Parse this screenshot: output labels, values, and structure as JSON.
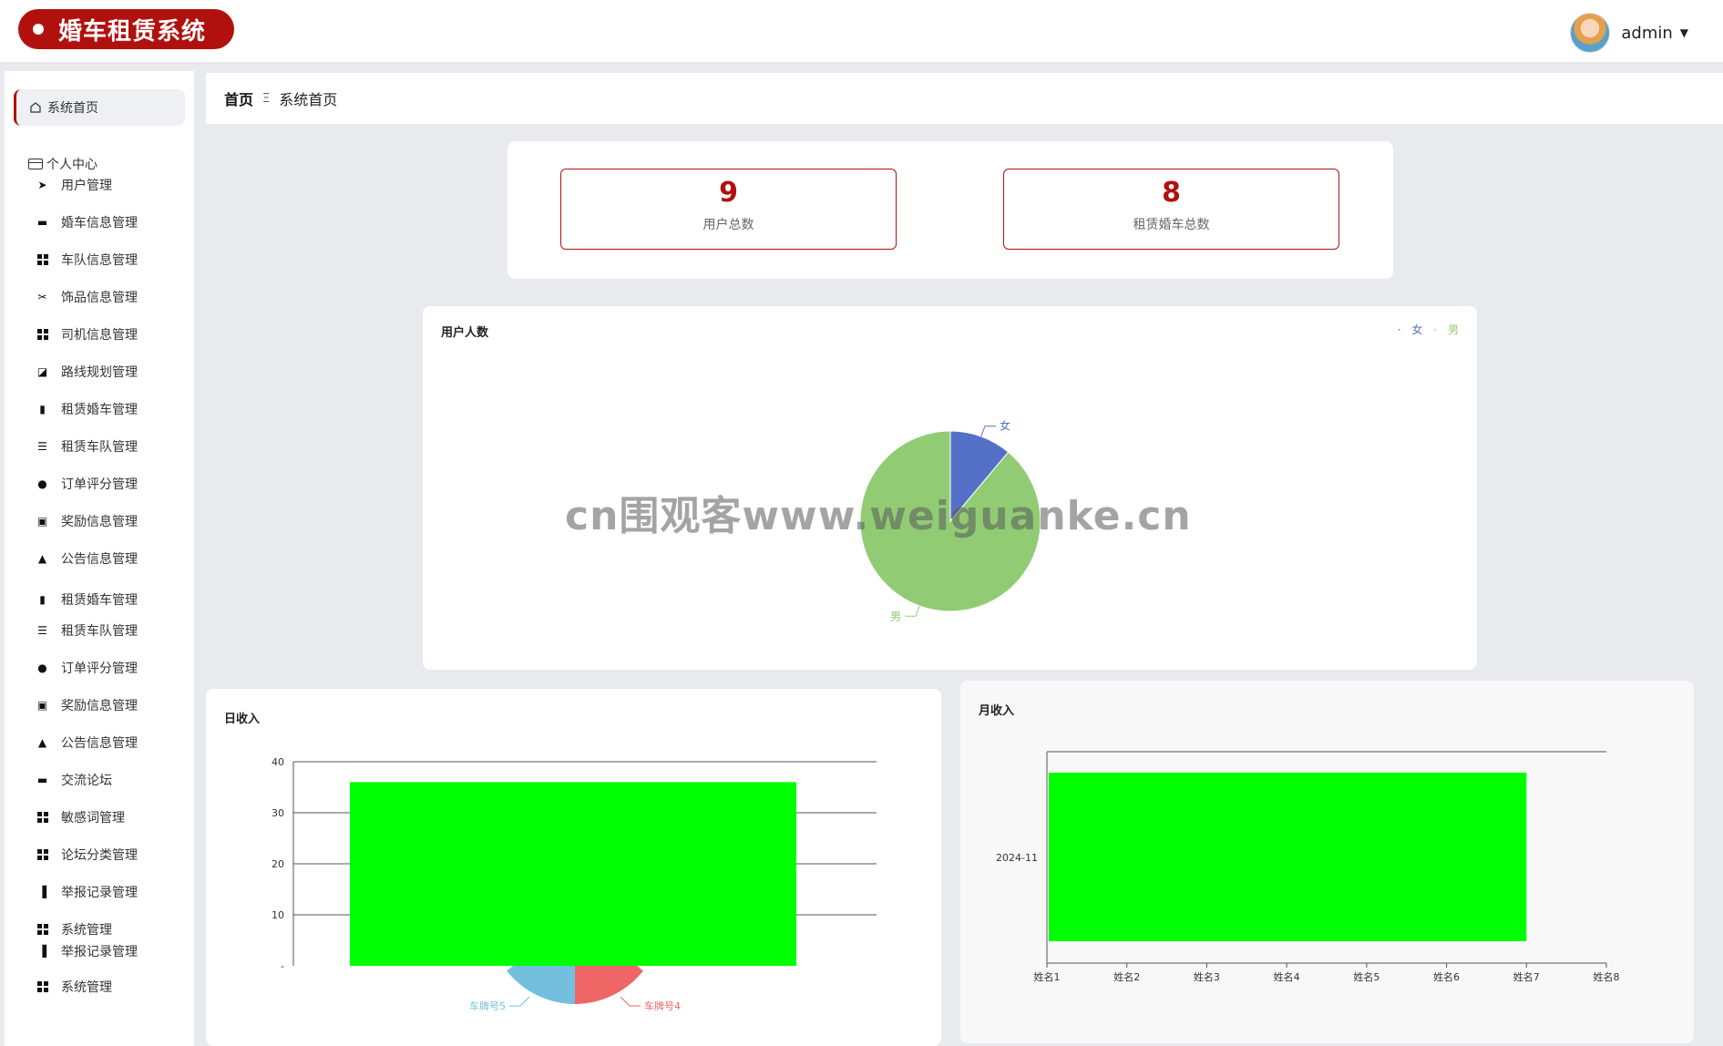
{
  "app": {
    "title": "婚车租赁系统",
    "user_name": "admin"
  },
  "sidebar": {
    "home": "系统首页",
    "section": "个人中心",
    "items": [
      {
        "label": "用户管理",
        "icon": "paper-plane-icon"
      },
      {
        "label": "婚车信息管理",
        "icon": "monitor-icon"
      },
      {
        "label": "车队信息管理",
        "icon": "grid-icon"
      },
      {
        "label": "饰品信息管理",
        "icon": "ticket-icon"
      },
      {
        "label": "司机信息管理",
        "icon": "grid-icon"
      },
      {
        "label": "路线规划管理",
        "icon": "line-chart-icon"
      },
      {
        "label": "租赁婚车管理",
        "icon": "clipboard-icon"
      },
      {
        "label": "租赁车队管理",
        "icon": "list-icon"
      },
      {
        "label": "订单评分管理",
        "icon": "balloon-icon"
      },
      {
        "label": "奖励信息管理",
        "icon": "clipboard-x-icon"
      },
      {
        "label": "公告信息管理",
        "icon": "person-icon"
      },
      {
        "label": "租赁婚车管理",
        "icon": "clipboard-icon"
      },
      {
        "label": "租赁车队管理",
        "icon": "list-icon"
      },
      {
        "label": "订单评分管理",
        "icon": "balloon-icon"
      },
      {
        "label": "奖励信息管理",
        "icon": "clipboard-x-icon"
      },
      {
        "label": "公告信息管理",
        "icon": "person-icon"
      },
      {
        "label": "交流论坛",
        "icon": "briefcase-icon"
      },
      {
        "label": "敏感词管理",
        "icon": "grid-icon"
      },
      {
        "label": "论坛分类管理",
        "icon": "grid-icon"
      },
      {
        "label": "举报记录管理",
        "icon": "bar-chart-icon"
      },
      {
        "label": "系统管理",
        "icon": "grid-icon"
      },
      {
        "label": "举报记录管理",
        "icon": "bar-chart-icon"
      },
      {
        "label": "系统管理",
        "icon": "grid-icon"
      }
    ]
  },
  "breadcrumb": {
    "home": "首页",
    "separator": "Ξ",
    "current": "系统首页"
  },
  "stats": [
    {
      "value": "9",
      "label": "用户总数"
    },
    {
      "value": "8",
      "label": "租赁婚车总数"
    }
  ],
  "watermark": "cn围观客www.weiguanke.cn",
  "colors": {
    "brand": "#b1110e",
    "female": "#5470c6",
    "male": "#91cc75",
    "bar": "#00ff00",
    "plate5": "#73c0de",
    "plate4": "#ee6666"
  },
  "chart_data": [
    {
      "type": "pie",
      "title": "用户人数",
      "categories": [
        "女",
        "男"
      ],
      "values": [
        1,
        8
      ],
      "legend": "top-right"
    },
    {
      "type": "bar",
      "title": "日收入",
      "categories": [
        ""
      ],
      "values": [
        36
      ],
      "ylim": [
        0,
        40
      ],
      "yticks": [
        "40",
        "30",
        "20",
        "10",
        "-"
      ],
      "grid": true,
      "background_pie_labels": [
        "车牌号5",
        "车牌号4"
      ]
    },
    {
      "type": "bar",
      "orientation": "horizontal",
      "title": "月收入",
      "categories": [
        "2024-11"
      ],
      "xticks": [
        "姓名1",
        "姓名2",
        "姓名3",
        "姓名4",
        "姓名5",
        "姓名6",
        "姓名7",
        "姓名8"
      ],
      "bar_start": "姓名1",
      "bar_end": "姓名7"
    }
  ]
}
